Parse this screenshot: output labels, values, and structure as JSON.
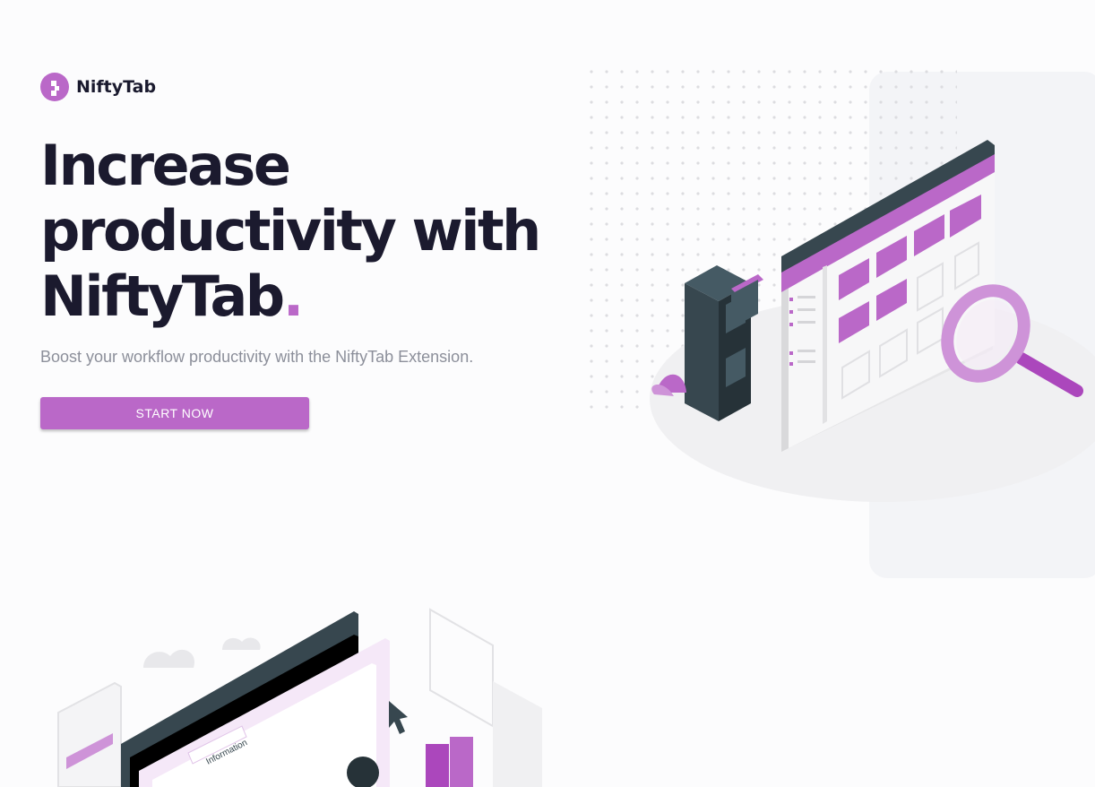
{
  "brand": {
    "name": "NiftyTab",
    "logo_icon": "niftytab-logo-icon"
  },
  "hero": {
    "title_line1": "Increase",
    "title_line2": "productivity with",
    "title_line3": "NiftyTab",
    "title_dot": ".",
    "subtitle": "Boost your workflow productivity with the NiftyTab Extension.",
    "cta_label": "START NOW"
  },
  "illustration_bottom": {
    "tab_label": "Information"
  },
  "colors": {
    "accent": "#ba68c8",
    "dark": "#1b1a2e",
    "muted": "#8c8f9a",
    "slate": "#37474f"
  }
}
